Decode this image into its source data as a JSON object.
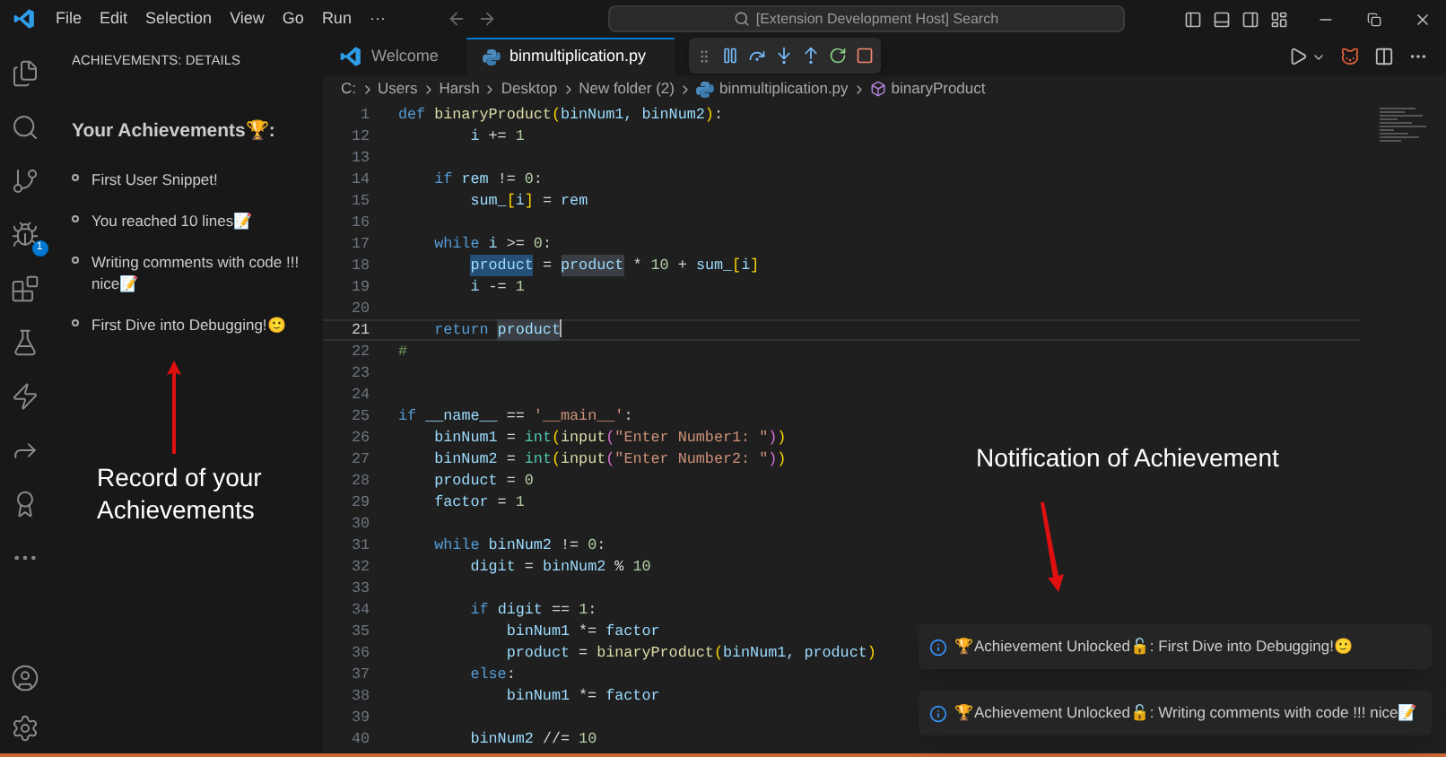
{
  "title_bar": {
    "menus": [
      "File",
      "Edit",
      "Selection",
      "View",
      "Go",
      "Run",
      "···"
    ],
    "search": {
      "placeholder": "[Extension Development Host] Search"
    }
  },
  "activity_bar": {
    "items": [
      {
        "kind": "files"
      },
      {
        "kind": "search"
      },
      {
        "kind": "source"
      },
      {
        "kind": "debug",
        "badge": "1"
      },
      {
        "kind": "extensions"
      },
      {
        "kind": "testing"
      },
      {
        "kind": "lightning"
      },
      {
        "kind": "remote"
      },
      {
        "kind": "award"
      },
      {
        "kind": "more"
      }
    ],
    "bottom": [
      {
        "kind": "account"
      },
      {
        "kind": "settings"
      }
    ]
  },
  "sidebar": {
    "title": "ACHIEVEMENTS: DETAILS",
    "heading": "Your Achievements🏆:",
    "items": [
      "First User Snippet!",
      "You reached 10 lines📝",
      "Writing comments with code !!! nice📝",
      "First Dive into Debugging!🙂"
    ]
  },
  "tabs": [
    {
      "label": "Welcome",
      "kind": "vscode",
      "selected": false
    },
    {
      "label": "binmultiplication.py",
      "kind": "python",
      "selected": true
    }
  ],
  "breadcrumbs": [
    {
      "label": "C:",
      "kind": "text"
    },
    {
      "label": "Users",
      "kind": "text"
    },
    {
      "label": "Harsh",
      "kind": "text"
    },
    {
      "label": "Desktop",
      "kind": "text"
    },
    {
      "label": "New folder (2)",
      "kind": "text"
    },
    {
      "label": "binmultiplication.py",
      "kind": "python"
    },
    {
      "label": "binaryProduct",
      "kind": "symbol"
    }
  ],
  "code": [
    {
      "number": "1",
      "current": false,
      "tokens": [
        {
          "text": "def",
          "kind": "keyword"
        },
        {
          "text": " binaryProduct",
          "kind": "function"
        },
        {
          "text": "(",
          "kind": "bracket"
        },
        {
          "text": "binNum1, binNum2",
          "kind": "variable"
        },
        {
          "text": ")",
          "kind": "bracket"
        },
        {
          "text": ":",
          "kind": "plain"
        }
      ]
    },
    {
      "number": "12",
      "current": false,
      "tokens": [
        {
          "text": "        i",
          "kind": "variable"
        },
        {
          "text": " += ",
          "kind": "plain"
        },
        {
          "text": "1",
          "kind": "number"
        }
      ]
    },
    {
      "number": "13",
      "current": false
    },
    {
      "number": "14",
      "current": false,
      "tokens": [
        {
          "text": "    if",
          "kind": "keyword"
        },
        {
          "text": " rem",
          "kind": "variable"
        },
        {
          "text": " != ",
          "kind": "plain"
        },
        {
          "text": "0",
          "kind": "number"
        },
        {
          "text": ":",
          "kind": "plain"
        }
      ]
    },
    {
      "number": "15",
      "current": false,
      "tokens": [
        {
          "text": "        sum_",
          "kind": "variable"
        },
        {
          "text": "[",
          "kind": "bracket"
        },
        {
          "text": "i",
          "kind": "variable"
        },
        {
          "text": "]",
          "kind": "bracket"
        },
        {
          "text": " = ",
          "kind": "plain"
        },
        {
          "text": "rem",
          "kind": "variable"
        }
      ]
    },
    {
      "number": "16",
      "current": false
    },
    {
      "number": "17",
      "current": false,
      "tokens": [
        {
          "text": "    while",
          "kind": "keyword"
        },
        {
          "text": " i",
          "kind": "variable"
        },
        {
          "text": " >= ",
          "kind": "plain"
        },
        {
          "text": "0",
          "kind": "number"
        },
        {
          "text": ":",
          "kind": "plain"
        }
      ]
    },
    {
      "number": "18",
      "current": false,
      "tokens": [
        {
          "text": "        product",
          "kind": "variable",
          "selected": true
        },
        {
          "text": " = ",
          "kind": "plain"
        },
        {
          "text": "product",
          "kind": "variable",
          "highlighted": true
        },
        {
          "text": " * ",
          "kind": "plain"
        },
        {
          "text": "10",
          "kind": "number"
        },
        {
          "text": " + ",
          "kind": "plain"
        },
        {
          "text": "sum_",
          "kind": "variable"
        },
        {
          "text": "[",
          "kind": "bracket"
        },
        {
          "text": "i",
          "kind": "variable"
        },
        {
          "text": "]",
          "kind": "bracket"
        }
      ]
    },
    {
      "number": "19",
      "current": false,
      "tokens": [
        {
          "text": "        i",
          "kind": "variable"
        },
        {
          "text": " -= ",
          "kind": "plain"
        },
        {
          "text": "1",
          "kind": "number"
        }
      ]
    },
    {
      "number": "20",
      "current": false
    },
    {
      "number": "21",
      "current": true,
      "tokens": [
        {
          "text": "    return",
          "kind": "keyword"
        },
        {
          "text": " product",
          "kind": "variable",
          "highlighted": true
        }
      ]
    },
    {
      "number": "22",
      "current": false,
      "tokens": [
        {
          "text": "#",
          "kind": "comment"
        }
      ]
    },
    {
      "number": "23",
      "current": false
    },
    {
      "number": "24",
      "current": false
    },
    {
      "number": "25",
      "current": false,
      "tokens": [
        {
          "text": "if",
          "kind": "keyword"
        },
        {
          "text": " __name__",
          "kind": "variable"
        },
        {
          "text": " == ",
          "kind": "plain"
        },
        {
          "text": "'__main__'",
          "kind": "string"
        },
        {
          "text": ":",
          "kind": "plain"
        }
      ]
    },
    {
      "number": "26",
      "current": false,
      "tokens": [
        {
          "text": "    binNum1",
          "kind": "variable"
        },
        {
          "text": " = ",
          "kind": "plain"
        },
        {
          "text": "int",
          "kind": "builtin"
        },
        {
          "text": "(",
          "kind": "bracket"
        },
        {
          "text": "input",
          "kind": "function"
        },
        {
          "text": "(",
          "kind": "bracket2"
        },
        {
          "text": "\"Enter Number1: \"",
          "kind": "string"
        },
        {
          "text": ")",
          "kind": "bracket2"
        },
        {
          "text": ")",
          "kind": "bracket"
        }
      ]
    },
    {
      "number": "27",
      "current": false,
      "tokens": [
        {
          "text": "    binNum2",
          "kind": "variable"
        },
        {
          "text": " = ",
          "kind": "plain"
        },
        {
          "text": "int",
          "kind": "builtin"
        },
        {
          "text": "(",
          "kind": "bracket"
        },
        {
          "text": "input",
          "kind": "function"
        },
        {
          "text": "(",
          "kind": "bracket2"
        },
        {
          "text": "\"Enter Number2: \"",
          "kind": "string"
        },
        {
          "text": ")",
          "kind": "bracket2"
        },
        {
          "text": ")",
          "kind": "bracket"
        }
      ]
    },
    {
      "number": "28",
      "current": false,
      "tokens": [
        {
          "text": "    product",
          "kind": "variable"
        },
        {
          "text": " = ",
          "kind": "plain"
        },
        {
          "text": "0",
          "kind": "number"
        }
      ]
    },
    {
      "number": "29",
      "current": false,
      "tokens": [
        {
          "text": "    factor",
          "kind": "variable"
        },
        {
          "text": " = ",
          "kind": "plain"
        },
        {
          "text": "1",
          "kind": "number"
        }
      ]
    },
    {
      "number": "30",
      "current": false
    },
    {
      "number": "31",
      "current": false,
      "tokens": [
        {
          "text": "    while",
          "kind": "keyword"
        },
        {
          "text": " binNum2",
          "kind": "variable"
        },
        {
          "text": " != ",
          "kind": "plain"
        },
        {
          "text": "0",
          "kind": "number"
        },
        {
          "text": ":",
          "kind": "plain"
        }
      ]
    },
    {
      "number": "32",
      "current": false,
      "tokens": [
        {
          "text": "        digit",
          "kind": "variable"
        },
        {
          "text": " = ",
          "kind": "plain"
        },
        {
          "text": "binNum2",
          "kind": "variable"
        },
        {
          "text": " % ",
          "kind": "plain"
        },
        {
          "text": "10",
          "kind": "number"
        }
      ]
    },
    {
      "number": "33",
      "current": false
    },
    {
      "number": "34",
      "current": false,
      "tokens": [
        {
          "text": "        if",
          "kind": "keyword"
        },
        {
          "text": " digit",
          "kind": "variable"
        },
        {
          "text": " == ",
          "kind": "plain"
        },
        {
          "text": "1",
          "kind": "number"
        },
        {
          "text": ":",
          "kind": "plain"
        }
      ]
    },
    {
      "number": "35",
      "current": false,
      "tokens": [
        {
          "text": "            binNum1",
          "kind": "variable"
        },
        {
          "text": " *= ",
          "kind": "plain"
        },
        {
          "text": "factor",
          "kind": "variable"
        }
      ]
    },
    {
      "number": "36",
      "current": false,
      "tokens": [
        {
          "text": "            product",
          "kind": "variable"
        },
        {
          "text": " = ",
          "kind": "plain"
        },
        {
          "text": "binaryProduct",
          "kind": "function"
        },
        {
          "text": "(",
          "kind": "bracket"
        },
        {
          "text": "binNum1, product",
          "kind": "variable"
        },
        {
          "text": ")",
          "kind": "bracket"
        }
      ]
    },
    {
      "number": "37",
      "current": false,
      "tokens": [
        {
          "text": "        else",
          "kind": "keyword"
        },
        {
          "text": ":",
          "kind": "plain"
        }
      ]
    },
    {
      "number": "38",
      "current": false,
      "tokens": [
        {
          "text": "            binNum1",
          "kind": "variable"
        },
        {
          "text": " *= ",
          "kind": "plain"
        },
        {
          "text": "factor",
          "kind": "variable"
        }
      ]
    },
    {
      "number": "39",
      "current": false
    },
    {
      "number": "40",
      "current": false,
      "tokens": [
        {
          "text": "        binNum2",
          "kind": "variable"
        },
        {
          "text": " //= ",
          "kind": "plain"
        },
        {
          "text": "10",
          "kind": "number"
        }
      ]
    }
  ],
  "annotations": [
    {
      "text": "Record of your Achievements",
      "kind": "up"
    },
    {
      "text": "Notification of Achievement",
      "kind": "down"
    }
  ],
  "notifications": [
    "🏆Achievement Unlocked🔓: First Dive into Debugging!🙂",
    "🏆Achievement Unlocked🔓: Writing comments with code !!! nice📝"
  ]
}
